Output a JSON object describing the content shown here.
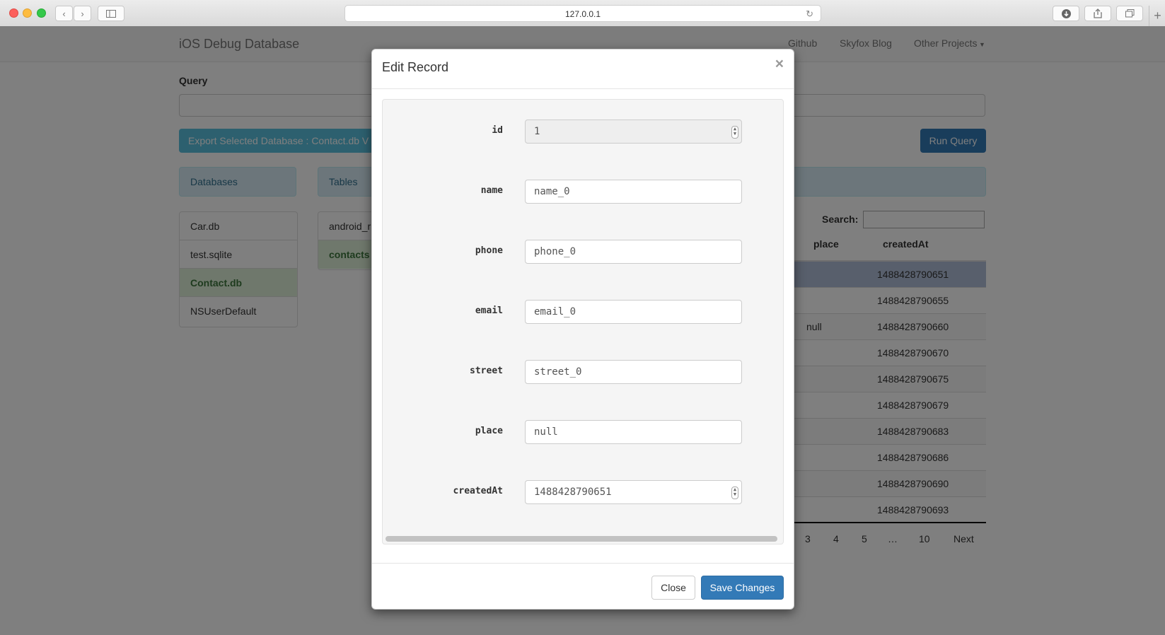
{
  "browser": {
    "url": "127.0.0.1",
    "back_icon": "chevron-left-icon",
    "forward_icon": "chevron-right-icon"
  },
  "navbar": {
    "brand": "iOS Debug Database",
    "links": [
      "Github",
      "Skyfox Blog",
      "Other Projects"
    ]
  },
  "query": {
    "label": "Query",
    "value": "",
    "export_label": "Export Selected Database : Contact.db V",
    "run_label": "Run Query"
  },
  "databases": {
    "header": "Databases",
    "items": [
      "Car.db",
      "test.sqlite",
      "Contact.db",
      "NSUserDefault"
    ],
    "active_index": 2
  },
  "tables": {
    "header": "Tables",
    "items": [
      "android_r",
      "contacts"
    ],
    "active_index": 1
  },
  "data_table": {
    "search_label": "Search:",
    "columns": [
      "place",
      "createdAt"
    ],
    "rows": [
      [
        "",
        "1488428790651"
      ],
      [
        "",
        "1488428790655"
      ],
      [
        "null",
        "1488428790660"
      ],
      [
        "",
        "1488428790670"
      ],
      [
        "",
        "1488428790675"
      ],
      [
        "",
        "1488428790679"
      ],
      [
        "",
        "1488428790683"
      ],
      [
        "",
        "1488428790686"
      ],
      [
        "",
        "1488428790690"
      ],
      [
        "",
        "1488428790693"
      ]
    ],
    "pagination": [
      "3",
      "4",
      "5",
      "…",
      "10",
      "Next"
    ]
  },
  "modal": {
    "title": "Edit Record",
    "close_symbol": "×",
    "fields": [
      {
        "label": "id",
        "value": "1"
      },
      {
        "label": "name",
        "value": "name_0"
      },
      {
        "label": "phone",
        "value": "phone_0"
      },
      {
        "label": "email",
        "value": "email_0"
      },
      {
        "label": "street",
        "value": "street_0"
      },
      {
        "label": "place",
        "value": "null"
      },
      {
        "label": "createdAt",
        "value": "1488428790651"
      }
    ],
    "close_label": "Close",
    "save_label": "Save Changes"
  },
  "colors": {
    "primary": "#337ab7",
    "info": "#5bc0de",
    "success_bg": "#dff0d8",
    "selected_row": "#b0bed9"
  }
}
